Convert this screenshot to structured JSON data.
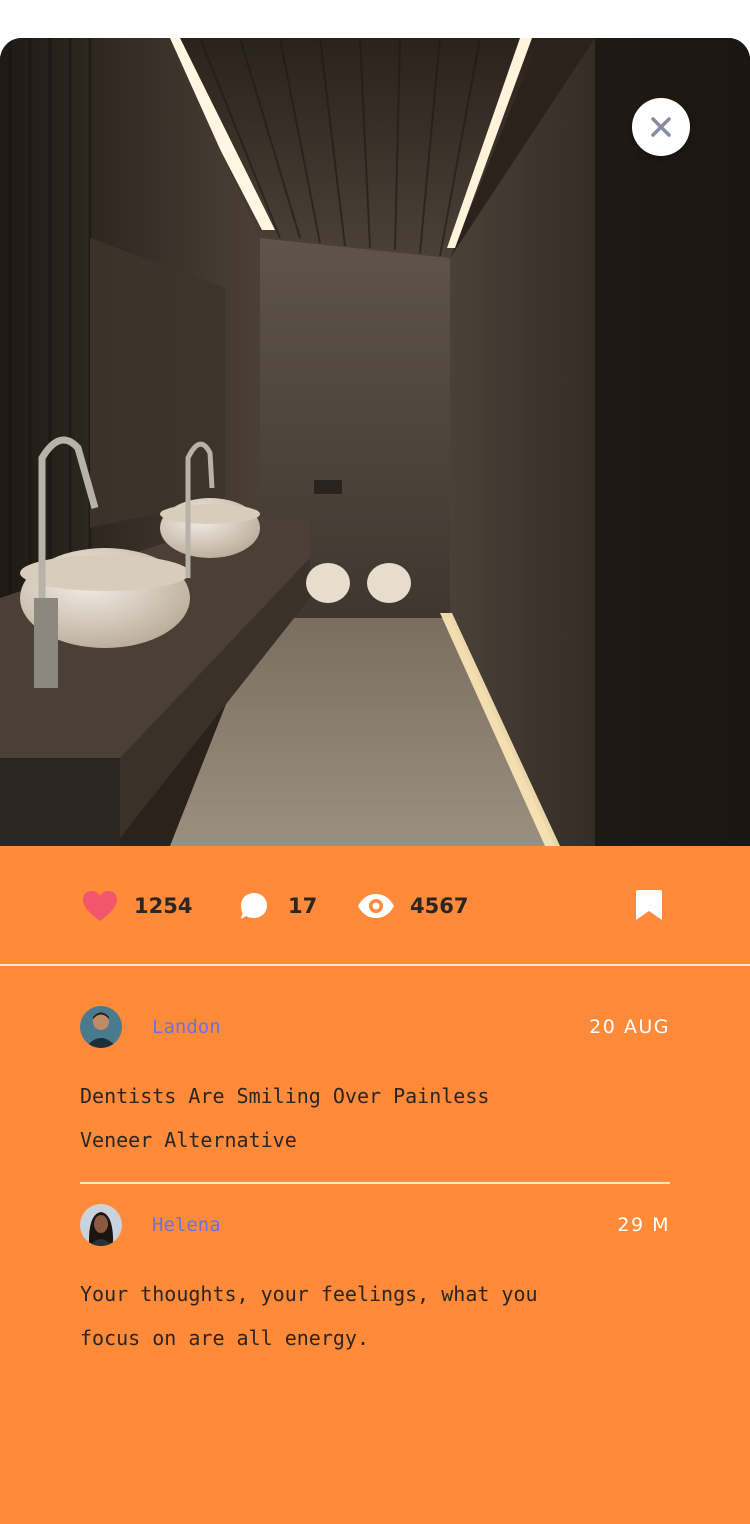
{
  "stats": {
    "likes": "1254",
    "comments": "17",
    "views": "4567"
  },
  "colors": {
    "accent_panel": "#ff8a3a",
    "heart": "#f2566a",
    "author_link": "#6b73d9",
    "close_icon": "#8a8aa0"
  },
  "icons": [
    "close-icon",
    "heart-icon",
    "comment-bubble-icon",
    "eye-icon",
    "bookmark-icon"
  ],
  "comments": [
    {
      "author": "Landon",
      "date": "20 AUG",
      "text": "Dentists Are Smiling Over Painless Veneer Alternative"
    },
    {
      "author": "Helena",
      "date": "29 M",
      "text": "Your thoughts, your feelings, what you focus on are all energy."
    }
  ]
}
